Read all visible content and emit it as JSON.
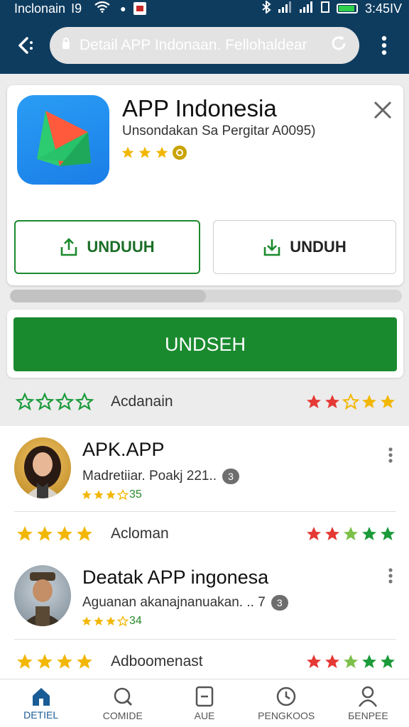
{
  "status_bar": {
    "carrier": "Inclonain",
    "network": "I9",
    "time": "3:45IV"
  },
  "appbar": {
    "url": "Detail APP Indonaan. Fellohaldear"
  },
  "app": {
    "title": "APP Indonesia",
    "subtitle": "Unsondakan Sa Pergitar A0095)",
    "rating_stars": 3,
    "close_icon": "close-icon"
  },
  "buttons": {
    "primary_outline": "UNDUUH",
    "secondary_outline": "UNDUH",
    "main_action": "UNDSEH"
  },
  "download_progress": 0.5,
  "rating_rows": [
    {
      "label": "Acdanain",
      "left_stars": 4,
      "right_colors": [
        "#e53935",
        "#e53935",
        "outline",
        "#f2b705",
        "#f2b705"
      ]
    },
    {
      "label": "Acloman",
      "left_stars": 4,
      "right_colors": [
        "#e53935",
        "#e53935",
        "#7cc04a",
        "#1b9a3a",
        "#1b9a3a"
      ]
    },
    {
      "label": "Adboomenast",
      "left_stars": 4,
      "right_colors": [
        "#e53935",
        "#e53935",
        "#7cc04a",
        "#1b9a3a",
        "#1b9a3a"
      ]
    }
  ],
  "list": [
    {
      "title": "APK.APP",
      "subtitle": "Madretiiar. Poakj 221..",
      "badge": "3",
      "stars": 4,
      "rating_value": "35"
    },
    {
      "title": "Deatak APP ingonesa",
      "subtitle": "Aguanan akanajnanuakan. ..  7",
      "badge": "3",
      "stars": 4,
      "rating_value": "34"
    }
  ],
  "bottom_nav": [
    {
      "label": "DETIEL",
      "icon": "home-icon",
      "active": true
    },
    {
      "label": "COMIDE",
      "icon": "search-icon",
      "active": false
    },
    {
      "label": "AUE",
      "icon": "minus-box-icon",
      "active": false
    },
    {
      "label": "PENGKOOS",
      "icon": "clock-icon",
      "active": false
    },
    {
      "label": "БENPEE",
      "icon": "person-icon",
      "active": false
    }
  ],
  "colors": {
    "appbar": "#0e3c5f",
    "primary_green": "#1a8a2f",
    "star_yellow": "#f2b705",
    "star_green": "#1b9a3a",
    "nav_active": "#1a5c95"
  }
}
